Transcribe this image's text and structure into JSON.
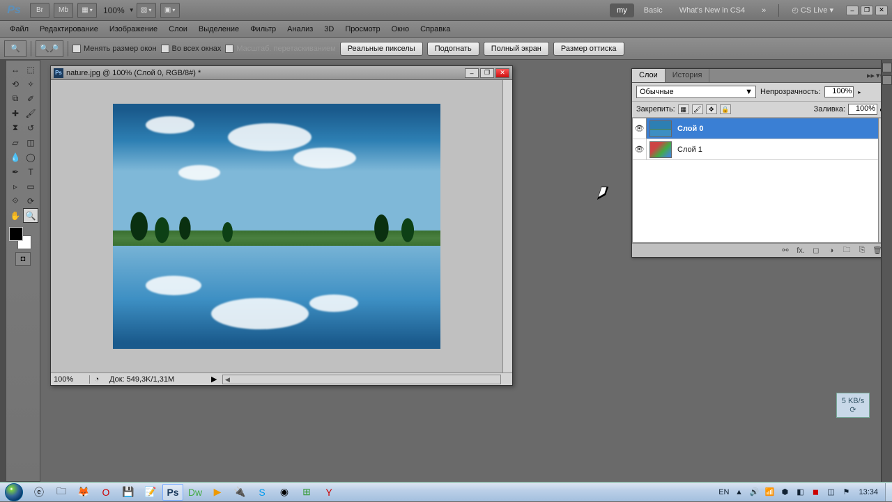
{
  "appbar": {
    "zoom": "100%",
    "workspaces": {
      "my": "my",
      "basic": "Basic",
      "whatsnew": "What's New in CS4"
    },
    "cslive": "CS Live"
  },
  "menu": {
    "file": "Файл",
    "edit": "Редактирование",
    "image": "Изображение",
    "layers": "Слои",
    "select": "Выделение",
    "filter": "Фильтр",
    "analysis": "Анализ",
    "3d": "3D",
    "view": "Просмотр",
    "window": "Окно",
    "help": "Справка"
  },
  "options": {
    "resize_windows": "Менять размер окон",
    "all_windows": "Во всех окнах",
    "scrubby": "Масштаб. перетаскиванием",
    "actual_pixels": "Реальные пикселы",
    "fit_screen": "Подогнать",
    "full_screen": "Полный экран",
    "print_size": "Размер оттиска"
  },
  "document": {
    "title": "nature.jpg @ 100% (Слой 0, RGB/8#) *",
    "zoom": "100%",
    "docinfo": "Док: 549,3K/1,31M"
  },
  "layers_panel": {
    "tab_layers": "Слои",
    "tab_history": "История",
    "blend_mode": "Обычные",
    "opacity_label": "Непрозрачность:",
    "opacity": "100%",
    "lock_label": "Закрепить:",
    "fill_label": "Заливка:",
    "fill": "100%",
    "layers": [
      {
        "name": "Слой 0"
      },
      {
        "name": "Слой 1"
      }
    ]
  },
  "net_widget": "5 KB/s",
  "taskbar": {
    "lang": "EN",
    "time": "13:34"
  }
}
